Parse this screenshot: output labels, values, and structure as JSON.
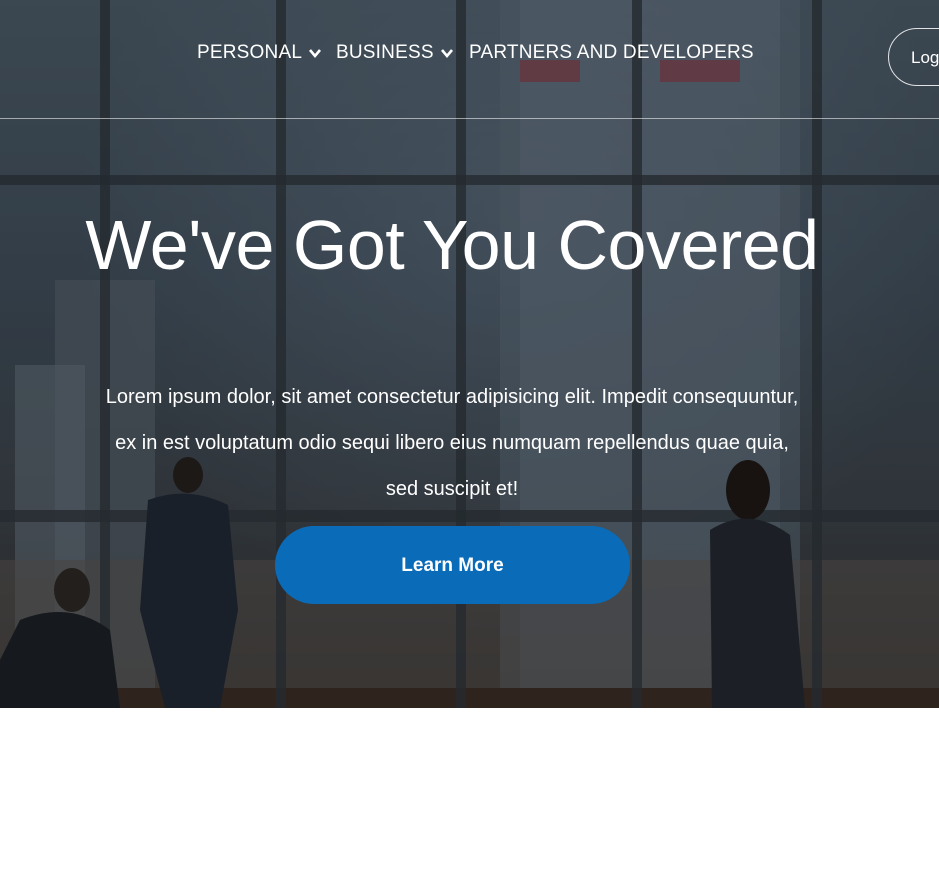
{
  "nav": {
    "items": [
      {
        "label": "PERSONAL",
        "has_dropdown": true
      },
      {
        "label": "BUSINESS",
        "has_dropdown": true
      },
      {
        "label": "PARTNERS AND DEVELOPERS",
        "has_dropdown": false
      }
    ],
    "login_label": "Login"
  },
  "hero": {
    "title": "We've Got You Covered",
    "text": "Lorem ipsum dolor, sit amet consectetur adipisicing elit. Impedit consequuntur, ex in est voluptatum odio sequi libero eius numquam repellendus quae quia, sed suscipit et!",
    "cta_label": "Learn More"
  },
  "colors": {
    "primary_button": "#0a6cb8",
    "nav_text": "#ffffff"
  }
}
